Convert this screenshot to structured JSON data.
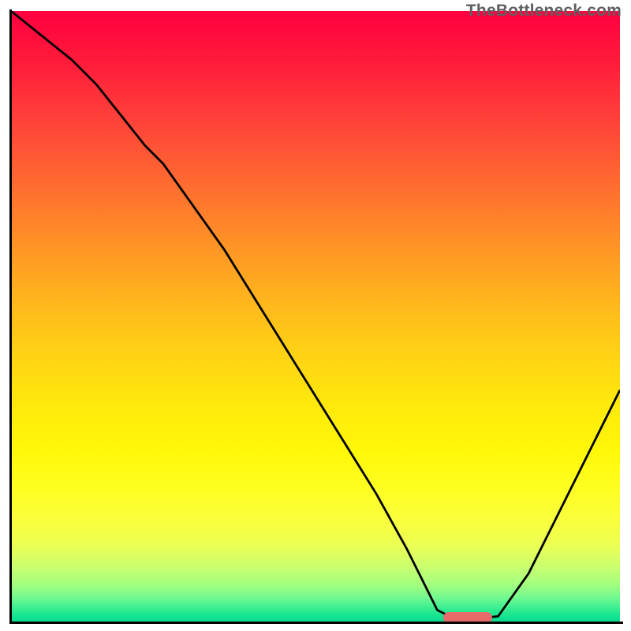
{
  "watermark": "TheBottleneck.com",
  "chart_data": {
    "type": "line",
    "title": "",
    "xlabel": "",
    "ylabel": "",
    "xlim": [
      0,
      100
    ],
    "ylim": [
      0,
      100
    ],
    "series": [
      {
        "name": "curve",
        "x": [
          0,
          5,
          10,
          14,
          18,
          22,
          25,
          30,
          35,
          40,
          45,
          50,
          55,
          60,
          65,
          68,
          70,
          73,
          76,
          80,
          85,
          90,
          95,
          100
        ],
        "y": [
          100,
          96,
          92,
          88,
          83,
          78,
          75,
          68,
          61,
          53,
          45,
          37,
          29,
          21,
          12,
          6,
          2,
          0.5,
          0.5,
          1,
          8,
          18,
          28,
          38
        ]
      }
    ],
    "marker": {
      "x_start": 71,
      "x_end": 79,
      "y": 0.8
    },
    "colors": {
      "gradient_top": "#ff0040",
      "gradient_bottom": "#0cd890",
      "curve": "#000000",
      "marker": "#e86a6a"
    }
  }
}
